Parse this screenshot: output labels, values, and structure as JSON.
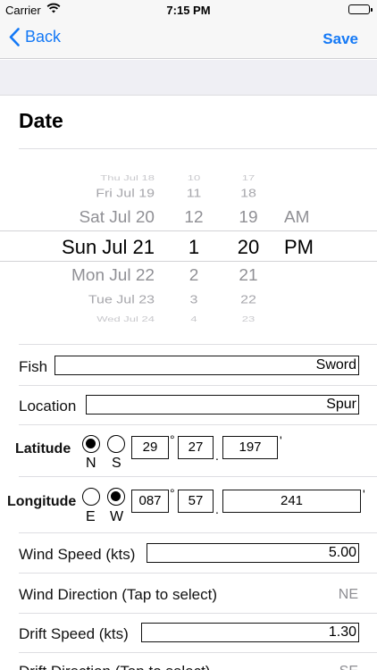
{
  "status": {
    "carrier": "Carrier",
    "time": "7:15 PM"
  },
  "nav": {
    "back_label": "Back",
    "save_label": "Save"
  },
  "date_section": {
    "title": "Date"
  },
  "picker": {
    "rows": [
      {
        "d": "Thu Jul 18",
        "h": "10",
        "m": "17",
        "ap": ""
      },
      {
        "d": "Fri Jul 19",
        "h": "11",
        "m": "18",
        "ap": ""
      },
      {
        "d": "Sat Jul 20",
        "h": "12",
        "m": "19",
        "ap": "AM"
      },
      {
        "d": "Sun Jul 21",
        "h": "1",
        "m": "20",
        "ap": "PM"
      },
      {
        "d": "Mon Jul 22",
        "h": "2",
        "m": "21",
        "ap": ""
      },
      {
        "d": "Tue Jul 23",
        "h": "3",
        "m": "22",
        "ap": ""
      },
      {
        "d": "Wed Jul 24",
        "h": "4",
        "m": "23",
        "ap": ""
      }
    ]
  },
  "form": {
    "fish_label": "Fish",
    "fish_value": "Sword",
    "location_label": "Location",
    "location_value": "Spur",
    "latitude": {
      "label": "Latitude",
      "n_label": "N",
      "s_label": "S",
      "selected": "N",
      "deg": "29",
      "min": "27",
      "frac": "197",
      "deg_sym": "°",
      "dot": ".",
      "min_sym": "'"
    },
    "longitude": {
      "label": "Longitude",
      "e_label": "E",
      "w_label": "W",
      "selected": "W",
      "deg": "087",
      "min": "57",
      "frac": "241",
      "deg_sym": "°",
      "dot": ".",
      "min_sym": "'"
    },
    "wind_speed_label": "Wind Speed (kts)",
    "wind_speed_value": "5.00",
    "wind_direction_label": "Wind Direction (Tap to select)",
    "wind_direction_value": "NE",
    "drift_speed_label": "Drift Speed (kts)",
    "drift_speed_value": "1.30",
    "drift_direction_label": "Drift Direction (Tap to select)",
    "drift_direction_value": "SE"
  }
}
